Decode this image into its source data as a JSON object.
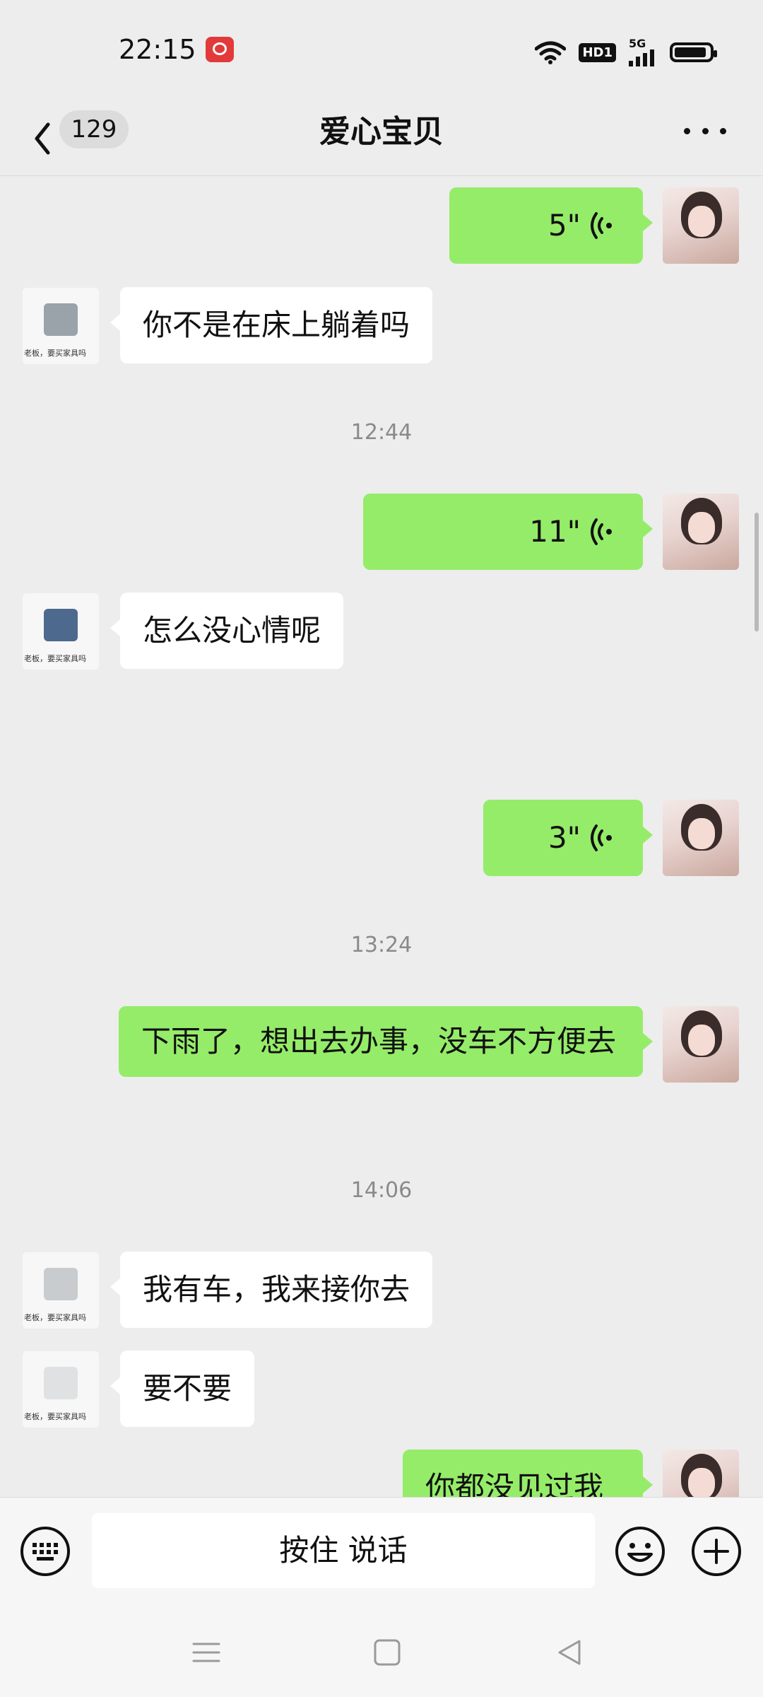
{
  "status_bar": {
    "time": "22:15",
    "network": "5G",
    "hd_label": "HD1"
  },
  "header": {
    "back_count": "129",
    "title": "爱心宝贝"
  },
  "colors": {
    "outgoing_bubble": "#95ec69",
    "incoming_bubble": "#ffffff",
    "background": "#ededed"
  },
  "contact": {
    "avatar_caption": "老板，要买家具吗"
  },
  "messages": {
    "m1": {
      "type": "voice",
      "direction": "out",
      "duration": "5\""
    },
    "m2": {
      "type": "text",
      "direction": "in",
      "text": "你不是在床上躺着吗"
    },
    "t1": "12:44",
    "m3": {
      "type": "voice",
      "direction": "out",
      "duration": "11\""
    },
    "m4": {
      "type": "text",
      "direction": "in",
      "text": "怎么没心情呢"
    },
    "m5": {
      "type": "voice",
      "direction": "out",
      "duration": "3\""
    },
    "t2": "13:24",
    "m6": {
      "type": "text",
      "direction": "out",
      "text": "下雨了，想出去办事，没车不方便去"
    },
    "t3": "14:06",
    "m7": {
      "type": "text",
      "direction": "in",
      "text": "我有车，我来接你去"
    },
    "m8": {
      "type": "text",
      "direction": "in",
      "text": "要不要"
    },
    "m9": {
      "type": "text",
      "direction": "out",
      "text": "你都没见过我"
    }
  },
  "input_bar": {
    "hold_to_talk": "按住 说话",
    "keyboard_icon": "keyboard-icon",
    "emoji_icon": "emoji-icon",
    "plus_icon": "plus-circle-icon"
  },
  "nav_bar": {
    "icons": [
      "menu-icon",
      "home-square-icon",
      "back-triangle-icon"
    ]
  }
}
